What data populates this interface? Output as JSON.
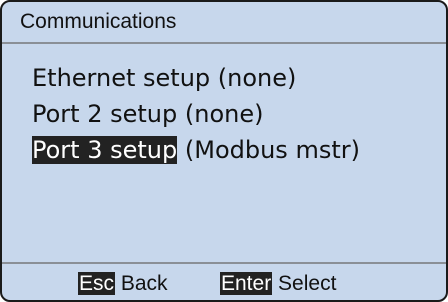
{
  "screen": {
    "title": "Communications"
  },
  "menu": {
    "items": [
      {
        "name": "Ethernet setup",
        "status": "(none)",
        "selected": false
      },
      {
        "name": "Port 2 setup",
        "status": "(none)",
        "selected": false
      },
      {
        "name": "Port 3 setup",
        "status": "(Modbus mstr)",
        "selected": true
      }
    ]
  },
  "footer": {
    "esc_key": "Esc",
    "esc_action": "Back",
    "enter_key": "Enter",
    "enter_action": "Select"
  },
  "colors": {
    "screen_background": "#c7d7ec",
    "highlight_background": "#222222",
    "highlight_text": "#ffffff"
  }
}
